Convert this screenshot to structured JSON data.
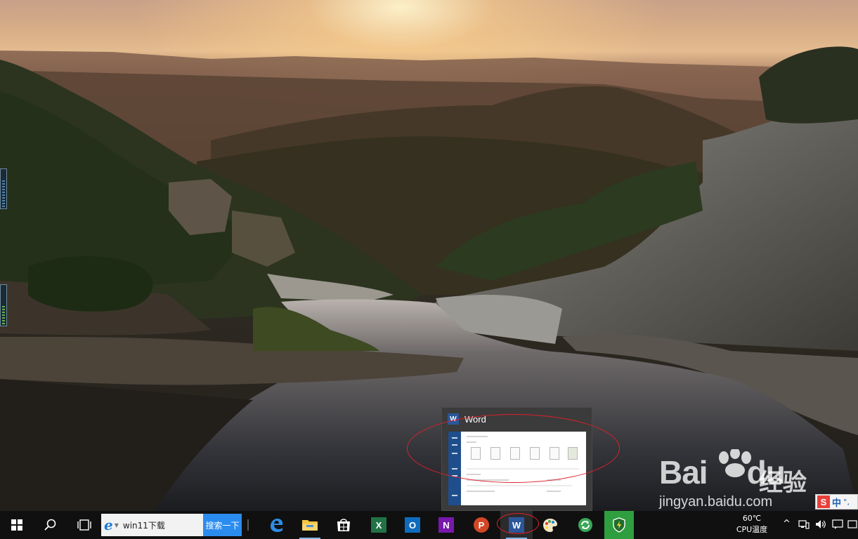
{
  "desktop": {
    "wallpaper": "sunset-valley-landscape"
  },
  "thumbnail": {
    "app_title": "Word",
    "app_icon": "word-icon",
    "preview": "word-start-screen"
  },
  "watermark": {
    "brand": "Bai",
    "brand_suffix": "du",
    "brand_cn": "经验",
    "url": "jingyan.baidu.com"
  },
  "ime": {
    "logo": "S",
    "mode": "中",
    "dots": "°,"
  },
  "taskbar": {
    "start_icon": "windows-logo-icon",
    "search_icon": "magnifier-icon",
    "taskview_icon": "task-view-icon",
    "search_box": {
      "engine_icon": "ie-icon",
      "query": "win11下载",
      "button_label": "搜索一下"
    },
    "apps": [
      {
        "name": "edge",
        "icon": "edge-icon",
        "running": false
      },
      {
        "name": "file-explorer",
        "icon": "folder-icon",
        "running": true
      },
      {
        "name": "store",
        "icon": "store-icon",
        "running": false
      },
      {
        "name": "excel",
        "icon": "excel-icon",
        "letter": "X",
        "running": false
      },
      {
        "name": "outlook",
        "icon": "outlook-icon",
        "letter": "O",
        "running": false
      },
      {
        "name": "onenote",
        "icon": "onenote-icon",
        "letter": "N",
        "running": false
      },
      {
        "name": "powerpoint",
        "icon": "powerpoint-icon",
        "letter": "P",
        "running": false
      },
      {
        "name": "word",
        "icon": "word-icon",
        "letter": "W",
        "running": true,
        "active": true
      },
      {
        "name": "paint",
        "icon": "paint-palette-icon",
        "running": false
      },
      {
        "name": "update-tool",
        "icon": "refresh-icon",
        "running": false
      },
      {
        "name": "security",
        "icon": "shield-icon",
        "running": false
      }
    ],
    "cpu": {
      "temp": "60℃",
      "label": "CPU温度"
    },
    "tray": {
      "chevron": "^",
      "icons": [
        "network-icon",
        "volume-icon",
        "action-center-icon"
      ]
    }
  },
  "colors": {
    "taskbar": "#101010",
    "search_button": "#2b8cf0",
    "annotation": "#e0202a",
    "word_blue": "#2b579a"
  }
}
